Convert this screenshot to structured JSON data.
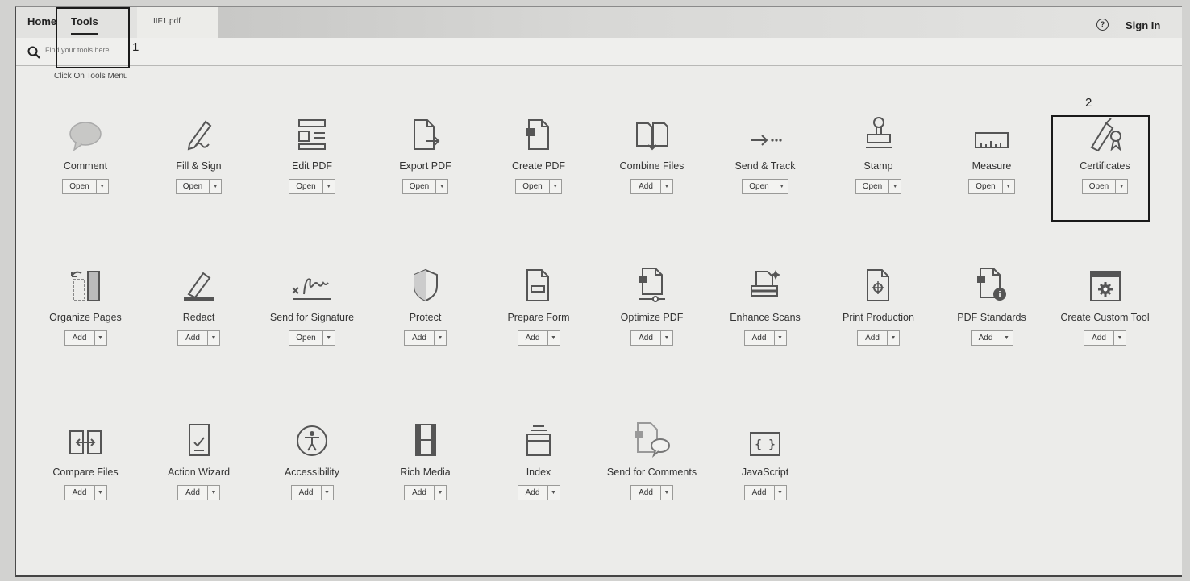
{
  "tabs": {
    "home": "Home",
    "tools": "Tools",
    "file": "IIF1.pdf"
  },
  "help_glyph": "?",
  "sign_in": "Sign In",
  "search": {
    "placeholder": "Find your tools here"
  },
  "annotations": {
    "one": "1",
    "two": "2",
    "caption": "Click On Tools Menu"
  },
  "rows": [
    [
      {
        "name": "Comment",
        "btn": "Open",
        "icon": "comment-icon"
      },
      {
        "name": "Fill & Sign",
        "btn": "Open",
        "icon": "fill-sign-icon"
      },
      {
        "name": "Edit PDF",
        "btn": "Open",
        "icon": "edit-pdf-icon"
      },
      {
        "name": "Export PDF",
        "btn": "Open",
        "icon": "export-pdf-icon"
      },
      {
        "name": "Create PDF",
        "btn": "Open",
        "icon": "create-pdf-icon"
      },
      {
        "name": "Combine Files",
        "btn": "Add",
        "icon": "combine-files-icon"
      },
      {
        "name": "Send & Track",
        "btn": "Open",
        "icon": "send-track-icon"
      },
      {
        "name": "Stamp",
        "btn": "Open",
        "icon": "stamp-icon"
      },
      {
        "name": "Measure",
        "btn": "Open",
        "icon": "measure-icon"
      },
      {
        "name": "Certificates",
        "btn": "Open",
        "icon": "certificates-icon"
      }
    ],
    [
      {
        "name": "Organize Pages",
        "btn": "Add",
        "icon": "organize-pages-icon"
      },
      {
        "name": "Redact",
        "btn": "Add",
        "icon": "redact-icon"
      },
      {
        "name": "Send for Signature",
        "btn": "Open",
        "icon": "send-signature-icon"
      },
      {
        "name": "Protect",
        "btn": "Add",
        "icon": "protect-icon"
      },
      {
        "name": "Prepare Form",
        "btn": "Add",
        "icon": "prepare-form-icon"
      },
      {
        "name": "Optimize PDF",
        "btn": "Add",
        "icon": "optimize-pdf-icon"
      },
      {
        "name": "Enhance Scans",
        "btn": "Add",
        "icon": "enhance-scans-icon"
      },
      {
        "name": "Print Production",
        "btn": "Add",
        "icon": "print-production-icon"
      },
      {
        "name": "PDF Standards",
        "btn": "Add",
        "icon": "pdf-standards-icon"
      },
      {
        "name": "Create Custom Tool",
        "btn": "Add",
        "icon": "custom-tool-icon"
      }
    ],
    [
      {
        "name": "Compare Files",
        "btn": "Add",
        "icon": "compare-files-icon"
      },
      {
        "name": "Action Wizard",
        "btn": "Add",
        "icon": "action-wizard-icon"
      },
      {
        "name": "Accessibility",
        "btn": "Add",
        "icon": "accessibility-icon"
      },
      {
        "name": "Rich Media",
        "btn": "Add",
        "icon": "rich-media-icon"
      },
      {
        "name": "Index",
        "btn": "Add",
        "icon": "index-icon"
      },
      {
        "name": "Send for Comments",
        "btn": "Add",
        "icon": "send-comments-icon"
      },
      {
        "name": "JavaScript",
        "btn": "Add",
        "icon": "javascript-icon"
      }
    ]
  ],
  "dropdown_glyph": "▼"
}
